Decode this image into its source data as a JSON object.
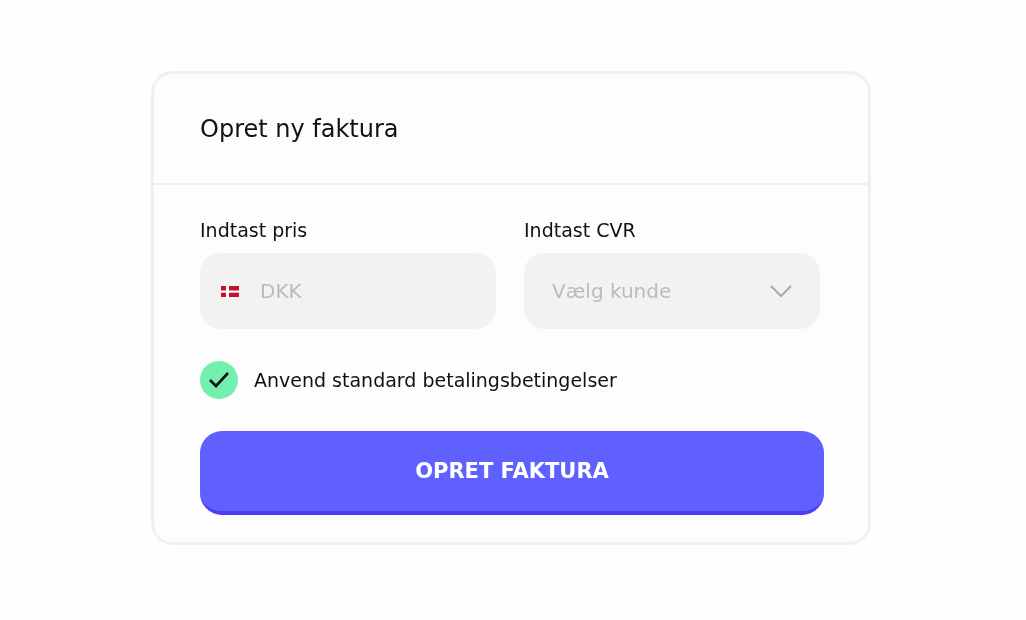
{
  "card": {
    "title": "Opret ny faktura"
  },
  "fields": [
    {
      "kind": "currency",
      "label": "Indtast pris",
      "placeholder": "DKK"
    },
    {
      "kind": "select",
      "label": "Indtast CVR",
      "placeholder": "Vælg kunde"
    }
  ],
  "checkbox": {
    "label": "Anvend standard betalingsbetingelser",
    "checked": true
  },
  "submit_button": {
    "label": "OPRET FAKTURA"
  }
}
